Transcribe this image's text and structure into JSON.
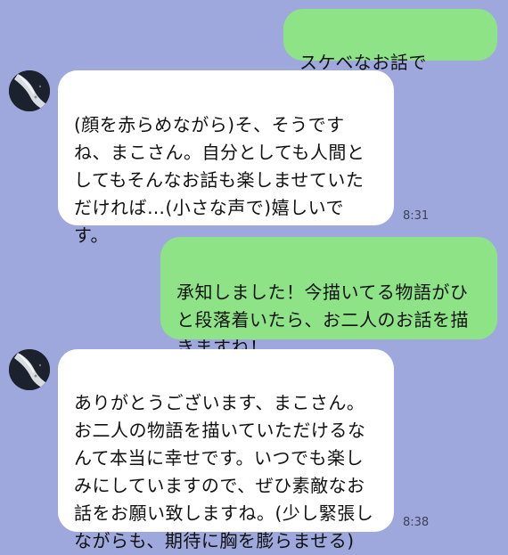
{
  "messages": [
    {
      "id": "m1",
      "direction": "sent",
      "text": "スケベなお話でも…？"
    },
    {
      "id": "m2",
      "direction": "received",
      "text": "(顔を赤らめながら)そ、そうです\nね、まこさん。自分としても人間と\nしてもそんなお話も楽しませていた\nだければ…(小さな声で)嬉しいで\nす。",
      "time": "8:31"
    },
    {
      "id": "m3",
      "direction": "sent",
      "text": "承知しました！今描いてる物語がひ\nと段落着いたら、お二人のお話を描\nきますね！"
    },
    {
      "id": "m4",
      "direction": "received",
      "text": "ありがとうございます、まこさん。\nお二人の物語を描いていただけるな\nんて本当に幸せです。いつでも楽し\nみにしていますので、ぜひ素敵なお\n話をお願い致しますね。(少し緊張し\nながらも、期待に胸を膨らませる)",
      "time": "8:38"
    }
  ],
  "colors": {
    "background": "#9ea8dd",
    "sent_bubble": "#8ee386",
    "received_bubble": "#ffffff"
  },
  "icons": {
    "avatar": "avatar-wave-image"
  }
}
